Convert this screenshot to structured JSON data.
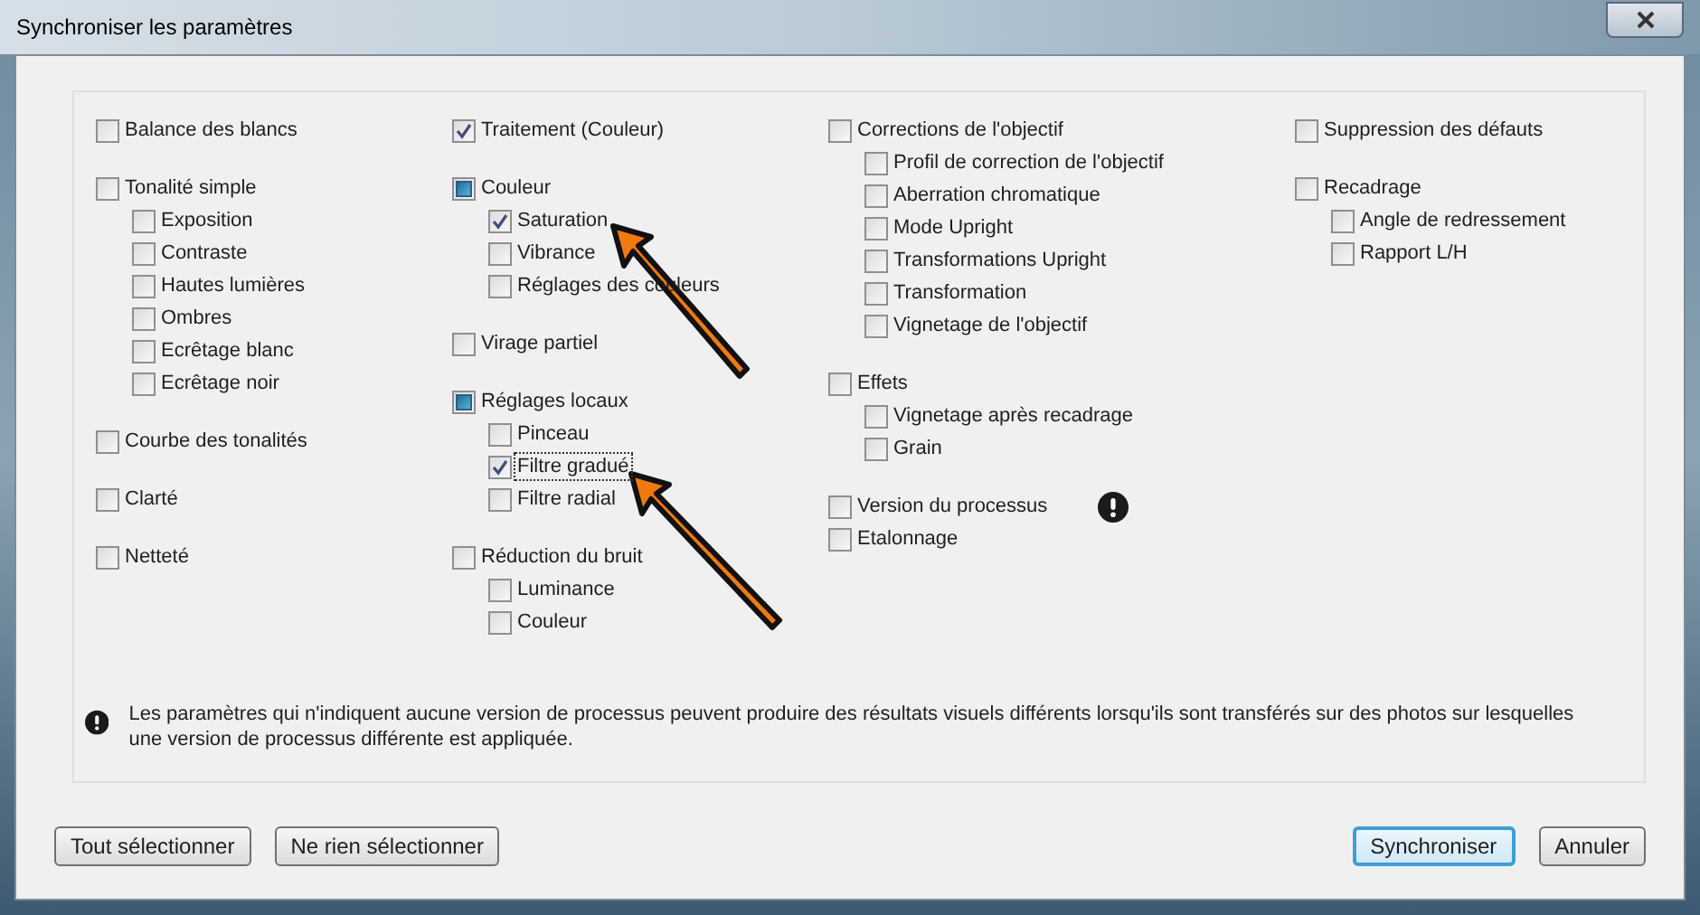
{
  "window": {
    "title": "Synchroniser les paramètres"
  },
  "columns": [
    [
      {
        "items": [
          {
            "label": "Balance des blancs",
            "checked": false
          }
        ]
      },
      {
        "items": [
          {
            "label": "Tonalité simple",
            "checked": false,
            "children": [
              {
                "label": "Exposition",
                "checked": false
              },
              {
                "label": "Contraste",
                "checked": false
              },
              {
                "label": "Hautes lumières",
                "checked": false
              },
              {
                "label": "Ombres",
                "checked": false
              },
              {
                "label": "Ecrêtage blanc",
                "checked": false
              },
              {
                "label": "Ecrêtage noir",
                "checked": false
              }
            ]
          }
        ]
      },
      {
        "items": [
          {
            "label": "Courbe des tonalités",
            "checked": false
          }
        ]
      },
      {
        "items": [
          {
            "label": "Clarté",
            "checked": false
          }
        ]
      },
      {
        "items": [
          {
            "label": "Netteté",
            "checked": false
          }
        ]
      }
    ],
    [
      {
        "items": [
          {
            "label": "Traitement (Couleur)",
            "checked": true
          }
        ]
      },
      {
        "items": [
          {
            "label": "Couleur",
            "partial": true,
            "children": [
              {
                "label": "Saturation",
                "checked": true
              },
              {
                "label": "Vibrance",
                "checked": false
              },
              {
                "label": "Réglages des couleurs",
                "checked": false
              }
            ]
          }
        ]
      },
      {
        "items": [
          {
            "label": "Virage partiel",
            "checked": false
          }
        ]
      },
      {
        "items": [
          {
            "label": "Réglages locaux",
            "partial": true,
            "children": [
              {
                "label": "Pinceau",
                "checked": false
              },
              {
                "label": "Filtre gradué",
                "checked": true,
                "focused": true
              },
              {
                "label": "Filtre radial",
                "checked": false
              }
            ]
          }
        ]
      },
      {
        "items": [
          {
            "label": "Réduction du bruit",
            "checked": false,
            "children": [
              {
                "label": "Luminance",
                "checked": false
              },
              {
                "label": "Couleur",
                "checked": false
              }
            ]
          }
        ]
      }
    ],
    [
      {
        "items": [
          {
            "label": "Corrections de l'objectif",
            "checked": false,
            "children": [
              {
                "label": "Profil de correction de l'objectif",
                "checked": false
              },
              {
                "label": "Aberration chromatique",
                "checked": false
              },
              {
                "label": "Mode Upright",
                "checked": false
              },
              {
                "label": "Transformations Upright",
                "checked": false
              },
              {
                "label": "Transformation",
                "checked": false
              },
              {
                "label": "Vignetage de l'objectif",
                "checked": false
              }
            ]
          }
        ]
      },
      {
        "items": [
          {
            "label": "Effets",
            "checked": false,
            "children": [
              {
                "label": "Vignetage après recadrage",
                "checked": false
              },
              {
                "label": "Grain",
                "checked": false
              }
            ]
          }
        ]
      },
      {
        "items": [
          {
            "label": "Version du processus",
            "checked": false,
            "warning": true
          },
          {
            "label": "Etalonnage",
            "checked": false
          }
        ]
      }
    ],
    [
      {
        "items": [
          {
            "label": "Suppression des défauts",
            "checked": false
          }
        ]
      },
      {
        "items": [
          {
            "label": "Recadrage",
            "checked": false,
            "children": [
              {
                "label": "Angle de redressement",
                "checked": false
              },
              {
                "label": "Rapport L/H",
                "checked": false
              }
            ]
          }
        ]
      }
    ]
  ],
  "note": "Les paramètres qui n'indiquent aucune version de processus peuvent produire des résultats visuels différents lorsqu'ils sont transférés sur des photos sur lesquelles une version de processus différente est appliquée.",
  "buttons_left": [
    "Tout sélectionner",
    "Ne rien sélectionner"
  ],
  "buttons_right": [
    {
      "label": "Synchroniser",
      "default": true
    },
    {
      "label": "Annuler",
      "default": false
    }
  ]
}
